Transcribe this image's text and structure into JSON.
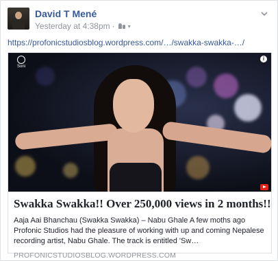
{
  "post": {
    "author": "David T Mené",
    "timestamp": "Yesterday at 4:38pm",
    "separator": "·",
    "audience_icon": "friends-icon",
    "link_text": "https://profonicstudiosblog.wordpress.com/…/swakka-swakka-…/"
  },
  "card": {
    "thumbnail_logo_text": "Soni",
    "info_glyph": "i",
    "title": "Swakka Swakka!! Over 250,000 views in 2 months!!",
    "description": "Aaja Aai Bhanchau (Swakka Swakka) – Nabu Ghale A few moths ago Profonic Studios had the pleasure of working with up and coming Nepalese recording artist, Nabu Ghale. The track is entitled 'Sw…",
    "domain": "PROFONICSTUDIOSBLOG.WORDPRESS.COM"
  },
  "colors": {
    "link": "#365899",
    "meta": "#90949c",
    "text": "#1d2129",
    "border": "#dddfe2"
  }
}
